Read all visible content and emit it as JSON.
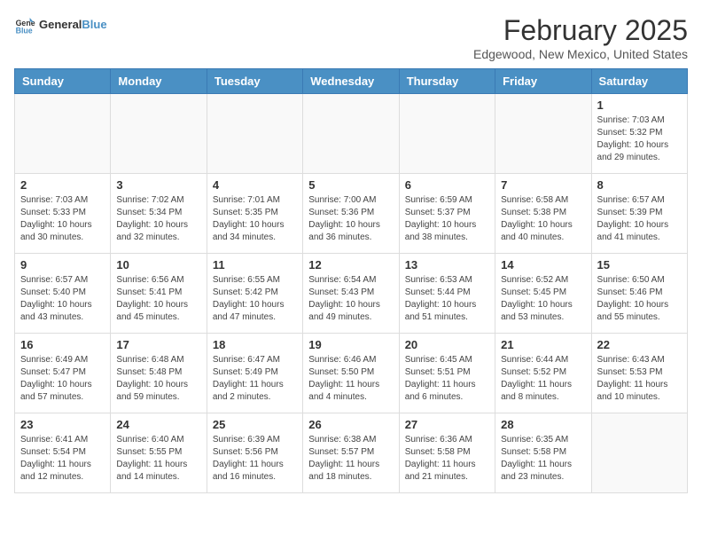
{
  "header": {
    "logo_line1": "General",
    "logo_line2": "Blue",
    "month_title": "February 2025",
    "location": "Edgewood, New Mexico, United States"
  },
  "weekdays": [
    "Sunday",
    "Monday",
    "Tuesday",
    "Wednesday",
    "Thursday",
    "Friday",
    "Saturday"
  ],
  "weeks": [
    [
      {
        "day": "",
        "info": ""
      },
      {
        "day": "",
        "info": ""
      },
      {
        "day": "",
        "info": ""
      },
      {
        "day": "",
        "info": ""
      },
      {
        "day": "",
        "info": ""
      },
      {
        "day": "",
        "info": ""
      },
      {
        "day": "1",
        "info": "Sunrise: 7:03 AM\nSunset: 5:32 PM\nDaylight: 10 hours\nand 29 minutes."
      }
    ],
    [
      {
        "day": "2",
        "info": "Sunrise: 7:03 AM\nSunset: 5:33 PM\nDaylight: 10 hours\nand 30 minutes."
      },
      {
        "day": "3",
        "info": "Sunrise: 7:02 AM\nSunset: 5:34 PM\nDaylight: 10 hours\nand 32 minutes."
      },
      {
        "day": "4",
        "info": "Sunrise: 7:01 AM\nSunset: 5:35 PM\nDaylight: 10 hours\nand 34 minutes."
      },
      {
        "day": "5",
        "info": "Sunrise: 7:00 AM\nSunset: 5:36 PM\nDaylight: 10 hours\nand 36 minutes."
      },
      {
        "day": "6",
        "info": "Sunrise: 6:59 AM\nSunset: 5:37 PM\nDaylight: 10 hours\nand 38 minutes."
      },
      {
        "day": "7",
        "info": "Sunrise: 6:58 AM\nSunset: 5:38 PM\nDaylight: 10 hours\nand 40 minutes."
      },
      {
        "day": "8",
        "info": "Sunrise: 6:57 AM\nSunset: 5:39 PM\nDaylight: 10 hours\nand 41 minutes."
      }
    ],
    [
      {
        "day": "9",
        "info": "Sunrise: 6:57 AM\nSunset: 5:40 PM\nDaylight: 10 hours\nand 43 minutes."
      },
      {
        "day": "10",
        "info": "Sunrise: 6:56 AM\nSunset: 5:41 PM\nDaylight: 10 hours\nand 45 minutes."
      },
      {
        "day": "11",
        "info": "Sunrise: 6:55 AM\nSunset: 5:42 PM\nDaylight: 10 hours\nand 47 minutes."
      },
      {
        "day": "12",
        "info": "Sunrise: 6:54 AM\nSunset: 5:43 PM\nDaylight: 10 hours\nand 49 minutes."
      },
      {
        "day": "13",
        "info": "Sunrise: 6:53 AM\nSunset: 5:44 PM\nDaylight: 10 hours\nand 51 minutes."
      },
      {
        "day": "14",
        "info": "Sunrise: 6:52 AM\nSunset: 5:45 PM\nDaylight: 10 hours\nand 53 minutes."
      },
      {
        "day": "15",
        "info": "Sunrise: 6:50 AM\nSunset: 5:46 PM\nDaylight: 10 hours\nand 55 minutes."
      }
    ],
    [
      {
        "day": "16",
        "info": "Sunrise: 6:49 AM\nSunset: 5:47 PM\nDaylight: 10 hours\nand 57 minutes."
      },
      {
        "day": "17",
        "info": "Sunrise: 6:48 AM\nSunset: 5:48 PM\nDaylight: 10 hours\nand 59 minutes."
      },
      {
        "day": "18",
        "info": "Sunrise: 6:47 AM\nSunset: 5:49 PM\nDaylight: 11 hours\nand 2 minutes."
      },
      {
        "day": "19",
        "info": "Sunrise: 6:46 AM\nSunset: 5:50 PM\nDaylight: 11 hours\nand 4 minutes."
      },
      {
        "day": "20",
        "info": "Sunrise: 6:45 AM\nSunset: 5:51 PM\nDaylight: 11 hours\nand 6 minutes."
      },
      {
        "day": "21",
        "info": "Sunrise: 6:44 AM\nSunset: 5:52 PM\nDaylight: 11 hours\nand 8 minutes."
      },
      {
        "day": "22",
        "info": "Sunrise: 6:43 AM\nSunset: 5:53 PM\nDaylight: 11 hours\nand 10 minutes."
      }
    ],
    [
      {
        "day": "23",
        "info": "Sunrise: 6:41 AM\nSunset: 5:54 PM\nDaylight: 11 hours\nand 12 minutes."
      },
      {
        "day": "24",
        "info": "Sunrise: 6:40 AM\nSunset: 5:55 PM\nDaylight: 11 hours\nand 14 minutes."
      },
      {
        "day": "25",
        "info": "Sunrise: 6:39 AM\nSunset: 5:56 PM\nDaylight: 11 hours\nand 16 minutes."
      },
      {
        "day": "26",
        "info": "Sunrise: 6:38 AM\nSunset: 5:57 PM\nDaylight: 11 hours\nand 18 minutes."
      },
      {
        "day": "27",
        "info": "Sunrise: 6:36 AM\nSunset: 5:58 PM\nDaylight: 11 hours\nand 21 minutes."
      },
      {
        "day": "28",
        "info": "Sunrise: 6:35 AM\nSunset: 5:58 PM\nDaylight: 11 hours\nand 23 minutes."
      },
      {
        "day": "",
        "info": ""
      }
    ]
  ]
}
